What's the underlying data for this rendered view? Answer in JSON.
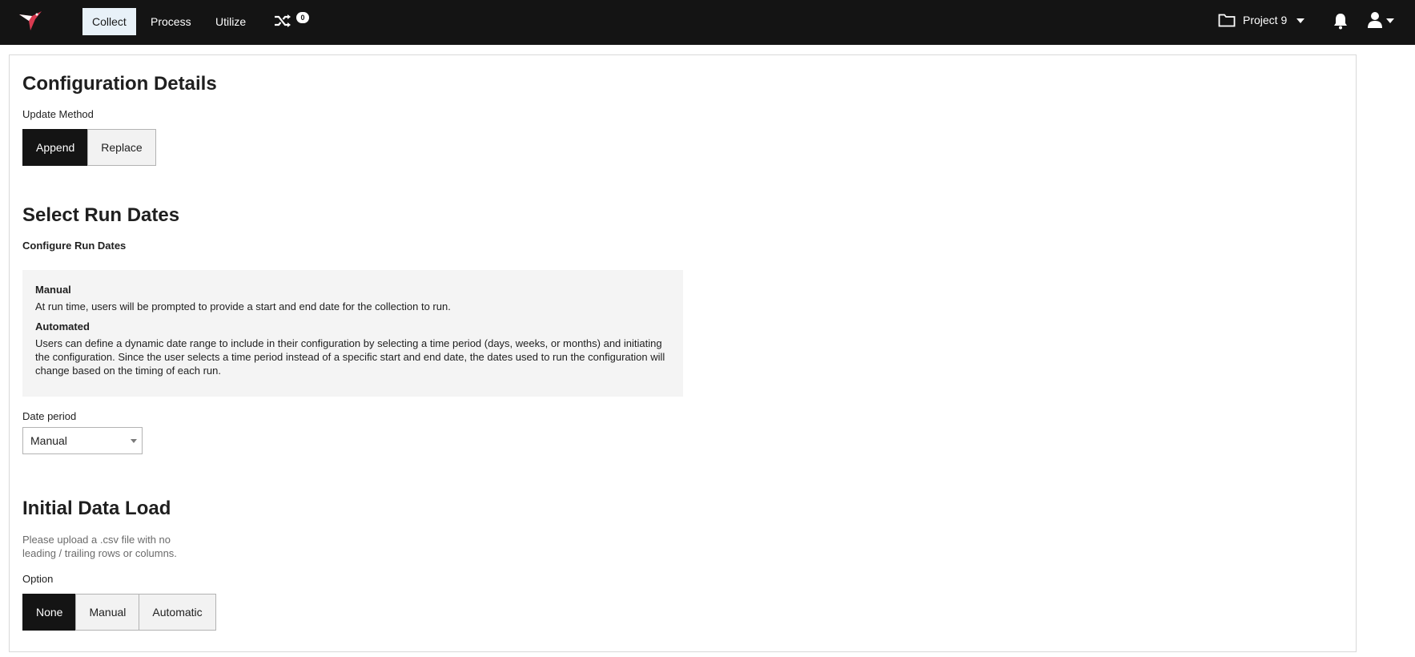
{
  "nav": {
    "items": [
      "Collect",
      "Process",
      "Utilize"
    ],
    "shuffle_badge": "0",
    "project_label": "Project 9",
    "icons": [
      "logo-icon",
      "shuffle-icon",
      "folder-icon",
      "bell-icon",
      "user-icon"
    ]
  },
  "config": {
    "title": "Configuration Details",
    "update_method_label": "Update Method",
    "update_method_options": [
      "Append",
      "Replace"
    ],
    "update_method_selected": "Append"
  },
  "run_dates": {
    "title": "Select Run Dates",
    "subtitle": "Configure Run Dates",
    "manual_title": "Manual",
    "manual_text": "At run time, users will be prompted to provide a start and end date for the collection to run.",
    "automated_title": "Automated",
    "automated_text": "Users can define a dynamic date range to include in their configuration by selecting a time period (days, weeks, or months) and initiating the configuration. Since the user selects a time period instead of a specific start and end date, the dates used to run the configuration will change based on the timing of each run.",
    "date_period_label": "Date period",
    "date_period_value": "Manual"
  },
  "initial_load": {
    "title": "Initial Data Load",
    "help_text": "Please upload a .csv file with no leading / trailing rows or columns.",
    "option_label": "Option",
    "options": [
      "None",
      "Manual",
      "Automatic"
    ],
    "selected": "None"
  },
  "colors": {
    "topbar": "#141414",
    "active_nav_bg": "#e8f1f8",
    "active_button": "#141414",
    "info_box_bg": "#f4f4f4"
  }
}
